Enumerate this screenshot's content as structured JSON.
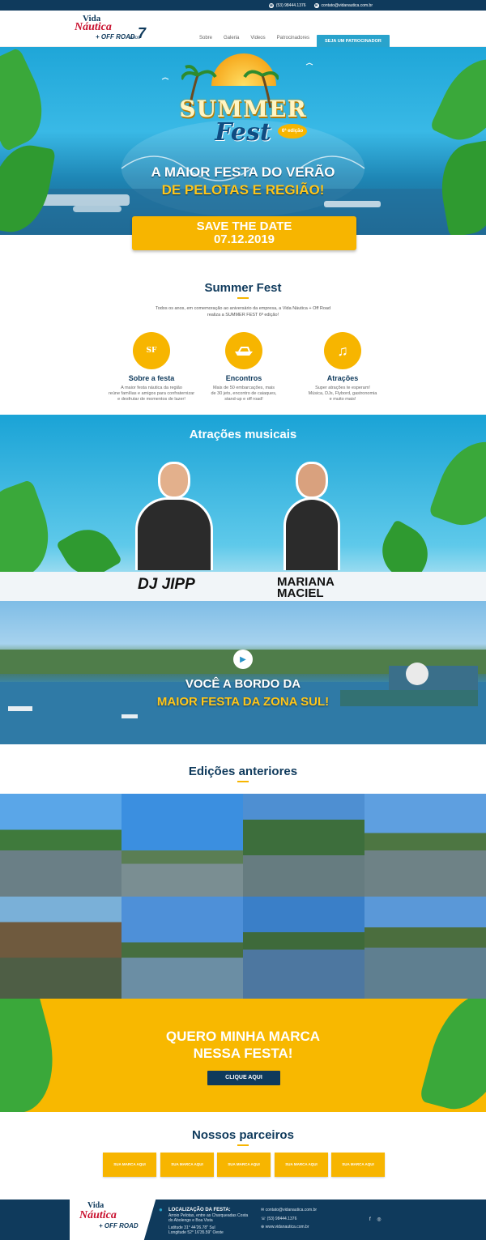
{
  "topbar": {
    "phone": "(53) 98444.1376",
    "email": "contato@vidanautica.com.br",
    "social": [
      "f",
      "◎"
    ]
  },
  "logo": {
    "line1": "Vida",
    "line2": "Náutica",
    "line3": "+ OFF ROAD",
    "anos_label": "anos",
    "anos": "7"
  },
  "nav": {
    "items": [
      "Sobre",
      "Galeria",
      "Videos",
      "Patrocinadores"
    ],
    "cta": "SEJA UM PATROCINADOR"
  },
  "hero": {
    "logo_summer": "SUMMER",
    "logo_fest": "Fest",
    "edition": "6ª edição",
    "tagline1": "A MAIOR FESTA DO VERÃO",
    "tagline2": "DE PELOTAS E REGIÃO!",
    "save_line1": "SAVE THE DATE",
    "save_line2": "07.12.2019"
  },
  "about": {
    "title": "Summer Fest",
    "intro1": "Todos os anos, em comemoração ao aniversário da empresa, a Vida Náutica + Off Road",
    "intro2": "realiza a SUMMER FEST 6ª edição!",
    "features": [
      {
        "title": "Sobre a festa",
        "icon": "summer-fest-logo-icon",
        "l1": "A maior festa náutica da região",
        "l2": "reúne famílias e amigos para confraternizar",
        "l3": "e desfrutar de momentos de lazer!"
      },
      {
        "title": "Encontros",
        "icon": "boat-icon",
        "l1": "Mais de 50 embarcações, mais",
        "l2": "de 30 jets, encontro de caiaques,",
        "l3": "stand-up e off road!"
      },
      {
        "title": "Atrações",
        "icon": "music-note-icon",
        "l1": "Super atrações te esperam!",
        "l2": "Música, DJs, Flybord, gastronomia",
        "l3": "e muito mais!"
      }
    ]
  },
  "music": {
    "title": "Atrações musicais",
    "artists": [
      "DJ JIPP",
      "MARIANA",
      "MACIEL"
    ]
  },
  "video": {
    "line1": "VOCÊ A BORDO DA",
    "line2": "MAIOR FESTA DA ZONA SUL!"
  },
  "previous": {
    "title": "Edições anteriores"
  },
  "cta": {
    "line1": "QUERO MINHA MARCA",
    "line2": "NESSA FESTA!",
    "button": "CLIQUE AQUI"
  },
  "partners": {
    "title": "Nossos parceiros",
    "slots": [
      "SUA MARCA AQUI",
      "SUA MARCA AQUI",
      "SUA MARCA AQUI",
      "SUA MARCA AQUI",
      "SUA MARCA AQUI"
    ]
  },
  "footer": {
    "loc_title": "LOCALIZAÇÃO DA FESTA:",
    "loc_l1": "Arroio Pelotas, entre as Charqueadas Costa",
    "loc_l2": "do Abolengo e Boa Vista",
    "lat": "Latitude  31° 44'26.78\" Sul",
    "lon": "Longitude 52° 16'35.59\" Oeste",
    "email": "contato@vidanautica.com.br",
    "phone": "(53) 98444.1376",
    "site": "www.vidanautica.com.br"
  },
  "colors": {
    "navy": "#0f3a5c",
    "yellow": "#f7b500",
    "blue": "#29a3cc",
    "red": "#c8102e"
  }
}
